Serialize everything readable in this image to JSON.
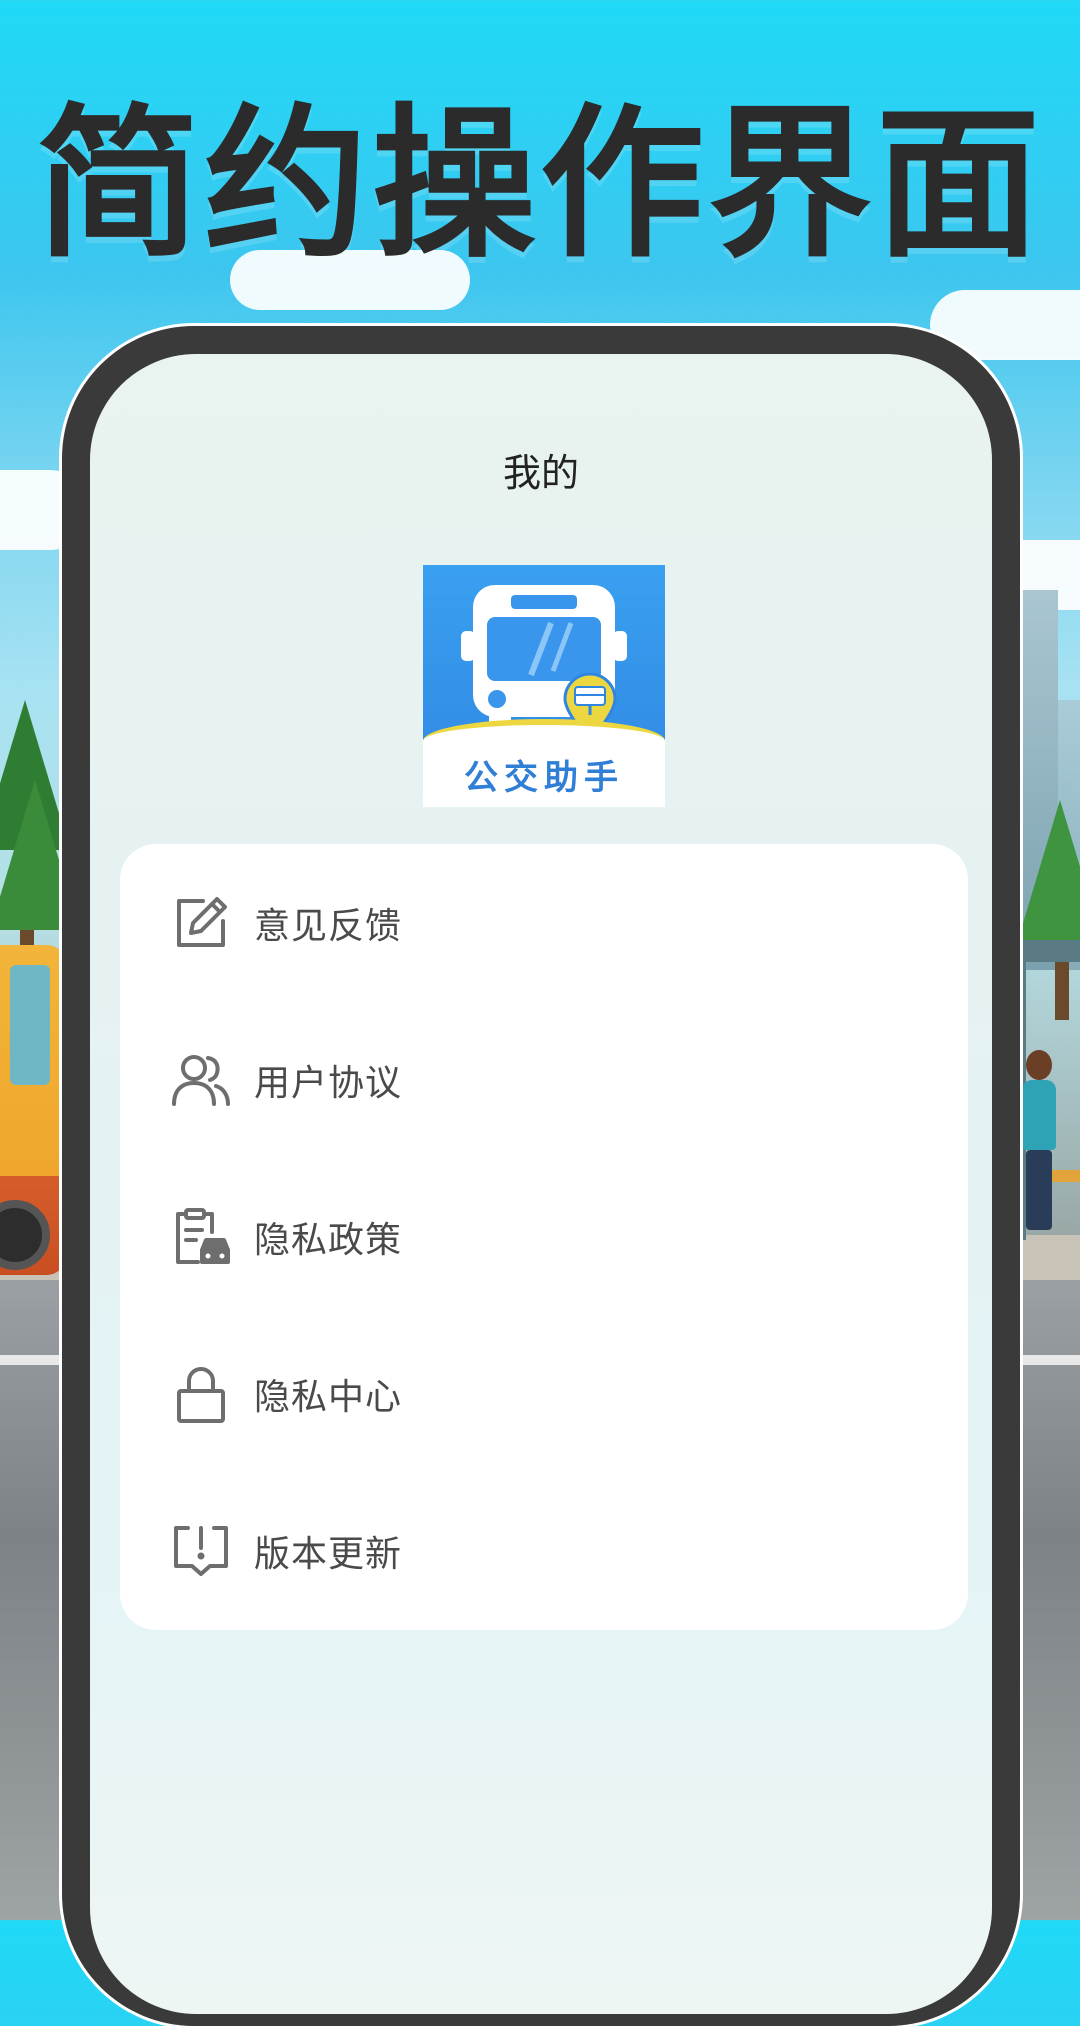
{
  "headline": "简约操作界面",
  "screen": {
    "title": "我的",
    "app_logo_text": "公交助手"
  },
  "menu": {
    "items": [
      {
        "label": "意见反馈",
        "icon": "edit-icon"
      },
      {
        "label": "用户协议",
        "icon": "users-icon"
      },
      {
        "label": "隐私政策",
        "icon": "clipboard-car-icon"
      },
      {
        "label": "隐私中心",
        "icon": "lock-icon"
      },
      {
        "label": "版本更新",
        "icon": "update-alert-icon"
      }
    ]
  },
  "colors": {
    "sky_top": "#1fd9f7",
    "phone_frame": "#3a3a3a",
    "logo_blue": "#2f86e2",
    "logo_yellow": "#ecd740",
    "icon_gray": "#6e6e6e",
    "label_gray": "#4a4a4a"
  }
}
